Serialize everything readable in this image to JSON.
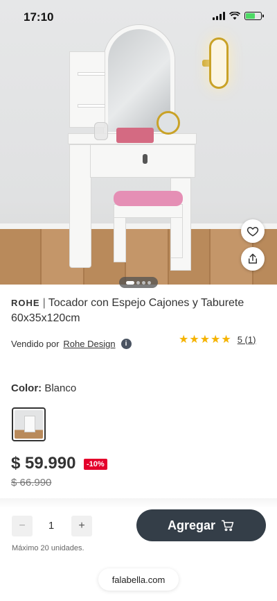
{
  "status": {
    "time": "17:10"
  },
  "product": {
    "brand": "ROHE",
    "separator": "|",
    "title": "Tocador con Espejo Cajones y Taburete 60x35x120cm",
    "seller_prefix": "Vendido por",
    "seller_name": "Rohe Design",
    "rating": {
      "stars": "★★★★★",
      "count": "5 (1)"
    },
    "color_label": "Color:",
    "color_value": "Blanco",
    "price": "$ 59.990",
    "discount": "-10%",
    "old_price": "$ 66.990"
  },
  "gallery": {
    "slide_count": 4,
    "active_slide": 1
  },
  "cart": {
    "qty_minus": "−",
    "qty_value": "1",
    "qty_plus": "+",
    "max_note": "Máximo 20 unidades.",
    "add_label": "Agregar"
  },
  "browser": {
    "url": "falabella.com"
  },
  "colors": {
    "discount_red": "#e4002b",
    "star_yellow": "#f5b301",
    "button_dark": "#343e48"
  },
  "icons": [
    "heart-icon",
    "share-icon",
    "info-icon",
    "cart-icon",
    "signal-icon",
    "wifi-icon",
    "battery-icon"
  ]
}
